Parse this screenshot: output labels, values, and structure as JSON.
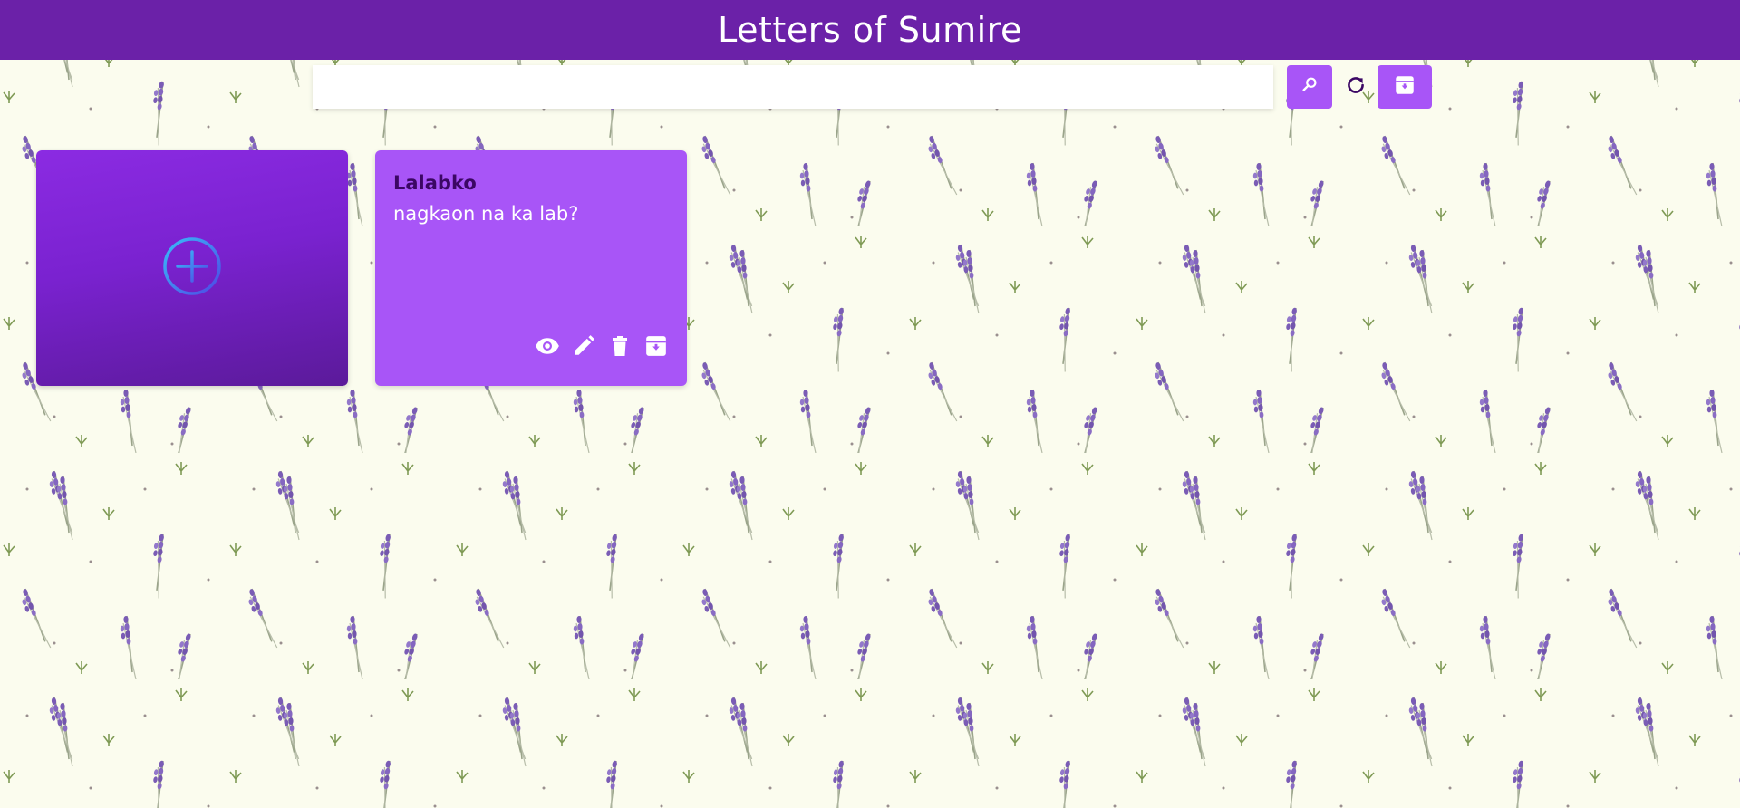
{
  "app": {
    "title": "Letters of Sumire"
  },
  "toolbar": {
    "search_value": "",
    "search_icon": "search-icon",
    "refresh_icon": "refresh-icon",
    "archive_icon": "archive-icon"
  },
  "add_card": {
    "icon": "add-circle-icon"
  },
  "notes": [
    {
      "title": "Lalabko",
      "body": "nagkaon na ka lab?",
      "actions": [
        "view-icon",
        "edit-icon",
        "delete-icon",
        "archive-icon"
      ]
    }
  ],
  "colors": {
    "header": "#6b21a8",
    "accent": "#a855f7",
    "note_title": "#3b0764",
    "background": "#fbfcee",
    "add_icon": "#3b82f6"
  }
}
